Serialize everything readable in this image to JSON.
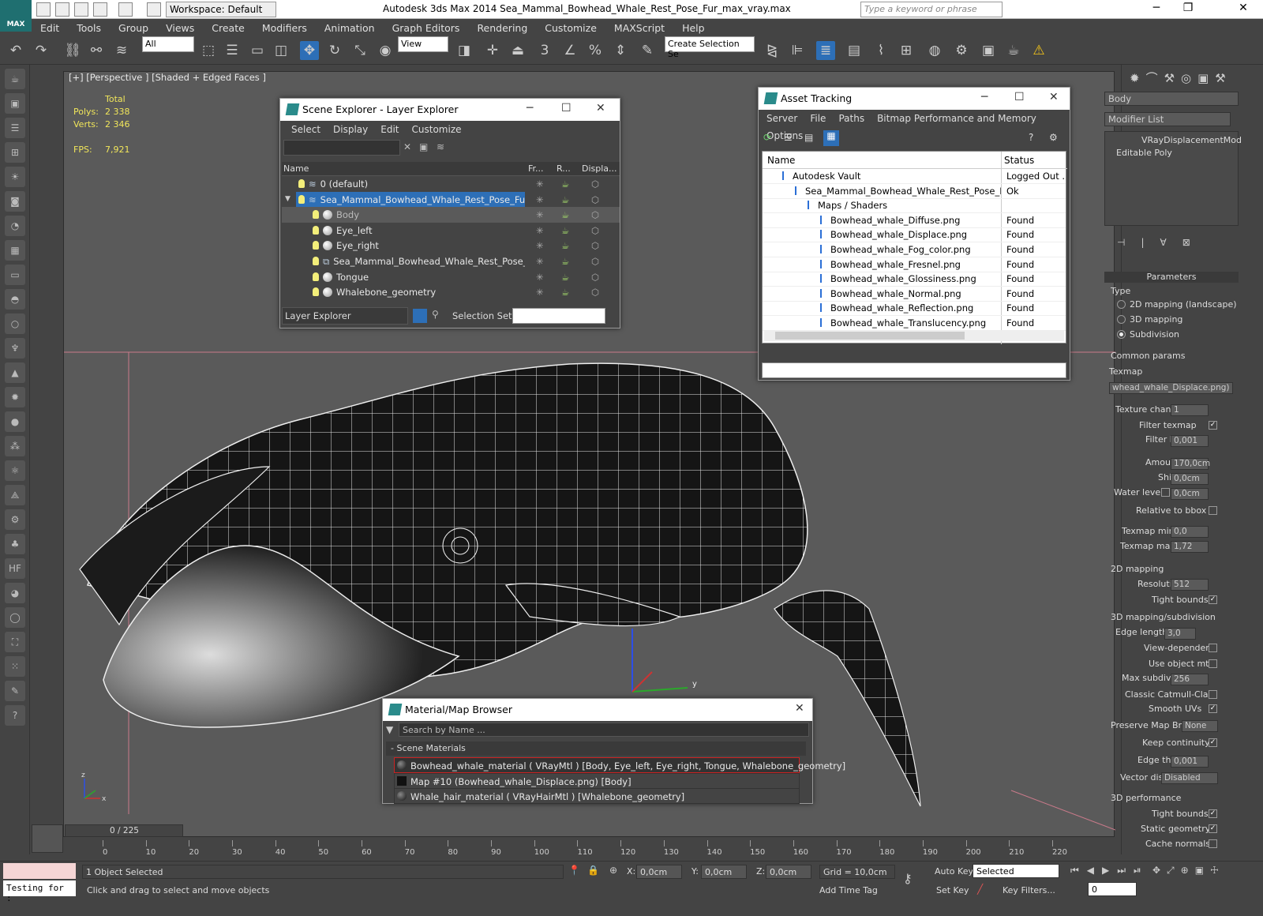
{
  "app": {
    "workspace": "Workspace: Default",
    "title": "Autodesk 3ds Max  2014    Sea_Mammal_Bowhead_Whale_Rest_Pose_Fur_max_vray.max",
    "search_placeholder": "Type a keyword or phrase",
    "logo": "MAX"
  },
  "menu": [
    "Edit",
    "Tools",
    "Group",
    "Views",
    "Create",
    "Modifiers",
    "Animation",
    "Graph Editors",
    "Rendering",
    "Customize",
    "MAXScript",
    "Help"
  ],
  "toolbar": {
    "filter": "All",
    "refcoord": "View",
    "selset": "Create Selection Se",
    "snap_labels": [
      "3",
      "%"
    ]
  },
  "viewport": {
    "label": "[+] [Perspective ] [Shaded + Edged Faces ]",
    "stats": {
      "total_label": "Total",
      "polys_label": "Polys:",
      "polys": "2 338",
      "verts_label": "Verts:",
      "verts": "2 346",
      "fps_label": "FPS:",
      "fps": "7,921"
    },
    "axes": {
      "y": "y",
      "x": "x",
      "z": "z"
    }
  },
  "scene_explorer": {
    "title": "Scene Explorer - Layer Explorer",
    "menu": [
      "Select",
      "Display",
      "Edit",
      "Customize"
    ],
    "columns": [
      "Name",
      "Fr...",
      "R...",
      "Displa..."
    ],
    "rows": [
      {
        "name": "0 (default)",
        "type": "layer",
        "indent": 0
      },
      {
        "name": "Sea_Mammal_Bowhead_Whale_Rest_Pose_Fur",
        "type": "layer",
        "indent": 0,
        "selected": true
      },
      {
        "name": "Body",
        "type": "obj",
        "indent": 1,
        "highlight": true
      },
      {
        "name": "Eye_left",
        "type": "obj",
        "indent": 1
      },
      {
        "name": "Eye_right",
        "type": "obj",
        "indent": 1
      },
      {
        "name": "Sea_Mammal_Bowhead_Whale_Rest_Pose_Fur",
        "type": "group",
        "indent": 1
      },
      {
        "name": "Tongue",
        "type": "obj",
        "indent": 1
      },
      {
        "name": "Whalebone_geometry",
        "type": "obj",
        "indent": 1
      }
    ],
    "footer_mode": "Layer Explorer",
    "selection_set_label": "Selection Set:"
  },
  "asset_tracking": {
    "title": "Asset Tracking",
    "menu": [
      "Server",
      "File",
      "Paths",
      "Bitmap Performance and Memory",
      "Options"
    ],
    "columns": [
      "Name",
      "Status"
    ],
    "rows": [
      {
        "name": "Autodesk Vault",
        "status": "Logged Out ...",
        "indent": 1
      },
      {
        "name": "Sea_Mammal_Bowhead_Whale_Rest_Pose_Fu...",
        "status": "Ok",
        "indent": 2
      },
      {
        "name": "Maps / Shaders",
        "status": "",
        "indent": 3
      },
      {
        "name": "Bowhead_whale_Diffuse.png",
        "status": "Found",
        "indent": 4
      },
      {
        "name": "Bowhead_whale_Displace.png",
        "status": "Found",
        "indent": 4
      },
      {
        "name": "Bowhead_whale_Fog_color.png",
        "status": "Found",
        "indent": 4
      },
      {
        "name": "Bowhead_whale_Fresnel.png",
        "status": "Found",
        "indent": 4
      },
      {
        "name": "Bowhead_whale_Glossiness.png",
        "status": "Found",
        "indent": 4
      },
      {
        "name": "Bowhead_whale_Normal.png",
        "status": "Found",
        "indent": 4
      },
      {
        "name": "Bowhead_whale_Reflection.png",
        "status": "Found",
        "indent": 4
      },
      {
        "name": "Bowhead_whale_Translucency.png",
        "status": "Found",
        "indent": 4
      }
    ]
  },
  "material_browser": {
    "title": "Material/Map Browser",
    "search_placeholder": "Search by Name ...",
    "group": "- Scene Materials",
    "items": [
      "Bowhead_whale_material  ( VRayMtl ) [Body, Eye_left, Eye_right, Tongue, Whalebone_geometry]",
      "Map #10 (Bowhead_whale_Displace.png) [Body]",
      "Whale_hair_material  ( VRayHairMtl ) [Whalebone_geometry]"
    ]
  },
  "command_panel": {
    "object_name": "Body",
    "modifier_list": "Modifier List",
    "stack": [
      "VRayDisplacementMod",
      "Editable Poly"
    ],
    "params_title": "Parameters",
    "type_label": "Type",
    "types": [
      "2D mapping (landscape)",
      "3D mapping",
      "Subdivision"
    ],
    "common_label": "Common params",
    "texmap_label": "Texmap",
    "texmap_value": "whead_whale_Displace.png)",
    "texture_chan_label": "Texture chan",
    "texture_chan": "1",
    "filter_texmap_label": "Filter texmap",
    "filter_blur_label": "Filter blur",
    "filter_blur": "0,001",
    "amount_label": "Amount",
    "amount": "170,0cm",
    "shift_label": "Shift",
    "shift": "0,0cm",
    "water_label": "Water level",
    "water": "0,0cm",
    "relative_label": "Relative to bbox",
    "texmin_label": "Texmap min",
    "texmin": "0,0",
    "texmax_label": "Texmap max",
    "texmax": "1,72",
    "map2d_label": "2D mapping",
    "resolution_label": "Resolution",
    "resolution": "512",
    "tight_label": "Tight bounds",
    "map3d_label": "3D mapping/subdivision",
    "edge_len_label": "Edge length",
    "edge_len": "3,0",
    "viewdep_label": "View-dependent",
    "useobj_label": "Use object mtl",
    "maxsub_label": "Max subdivs",
    "maxsub": "256",
    "catmull_label": "Classic Catmull-Clark",
    "smooth_label": "Smooth UVs",
    "preserve_label": "Preserve Map Bnd",
    "preserve": "None",
    "keep_label": "Keep continuity",
    "edge_thresh_label": "Edge thresh",
    "edge_thresh": "0,001",
    "vector_label": "Vector displ",
    "vector": "Disabled",
    "perf_label": "3D performance",
    "perf_tight": "Tight bounds",
    "static_label": "Static geometry",
    "cache_label": "Cache normals"
  },
  "timeline": {
    "frame": "0 / 225",
    "ticks": [
      "0",
      "10",
      "20",
      "30",
      "40",
      "50",
      "60",
      "70",
      "80",
      "90",
      "100",
      "110",
      "120",
      "130",
      "140",
      "150",
      "160",
      "170",
      "180",
      "190",
      "200",
      "210",
      "220"
    ]
  },
  "status": {
    "script": "Testing for :",
    "selected": "1 Object Selected",
    "prompt": "Click and drag to select and move objects",
    "x_label": "X:",
    "x": "0,0cm",
    "y_label": "Y:",
    "y": "0,0cm",
    "z_label": "Z:",
    "z": "0,0cm",
    "grid": "Grid = 10,0cm",
    "addtime": "Add Time Tag",
    "autokey": "Auto Key",
    "setkey": "Set Key",
    "keymode": "Selected",
    "keyfilters": "Key Filters...",
    "frame_field": "0"
  }
}
